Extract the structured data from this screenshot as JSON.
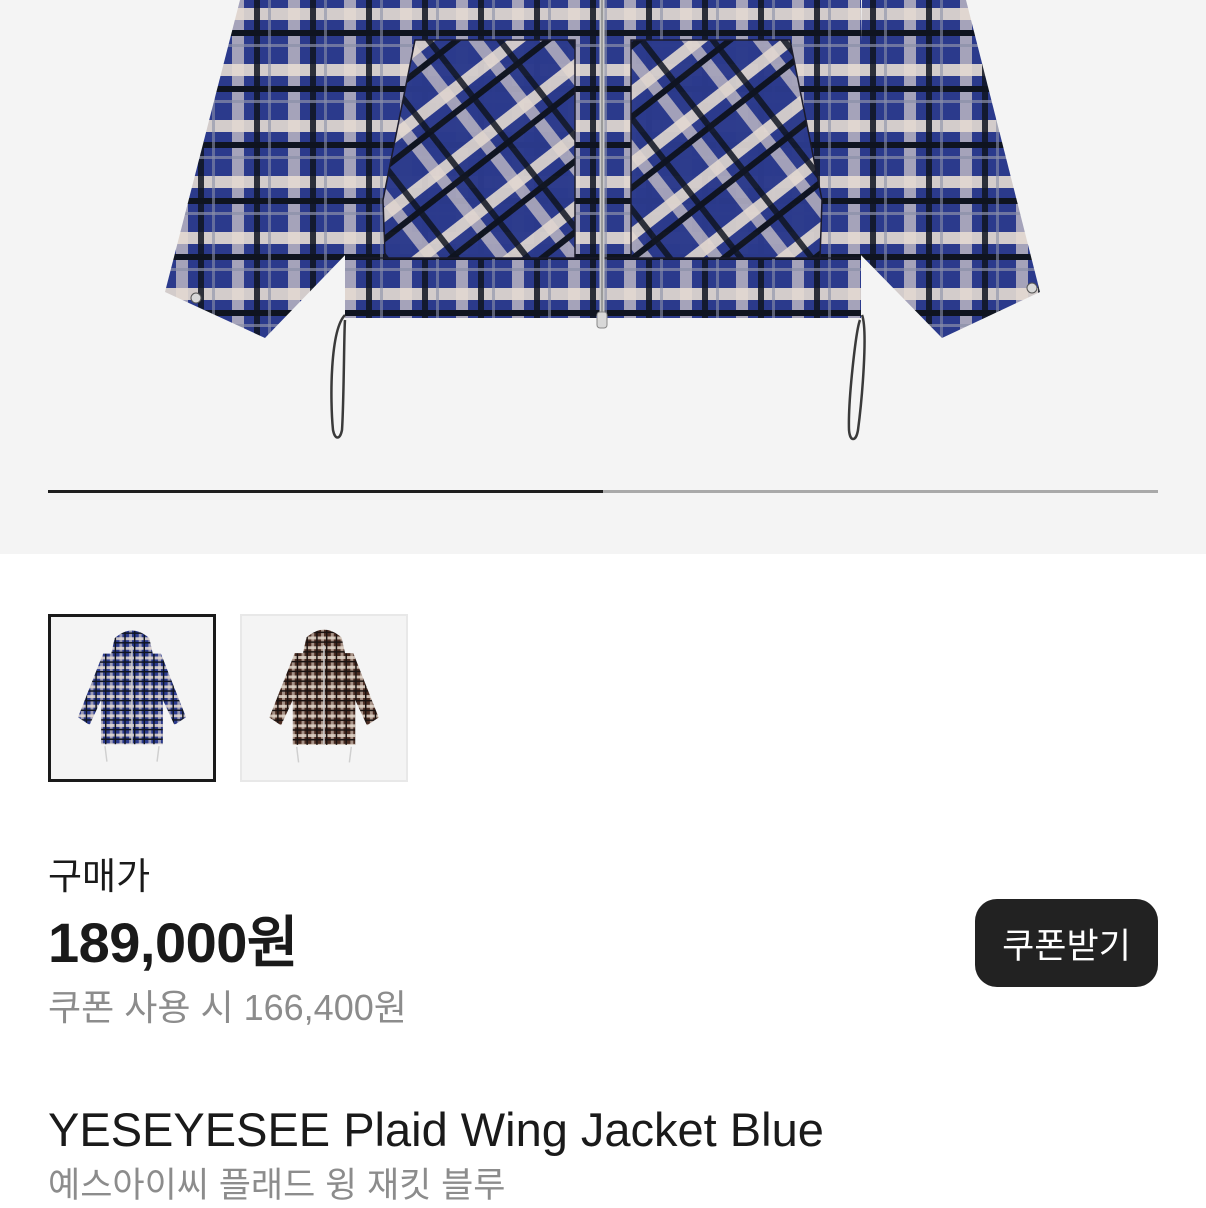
{
  "gallery": {
    "progress_fraction": 0.5,
    "colors": {
      "fill": "#1e1e1e",
      "track": "#a9a9a9",
      "background": "#f4f4f4"
    },
    "thumbnails": [
      {
        "name": "blue-plaid-jacket",
        "selected": true,
        "plaid_base": "#2b3a8c",
        "plaid_light": "#e6dcd2"
      },
      {
        "name": "brown-plaid-jacket",
        "selected": false,
        "plaid_base": "#4a2c22",
        "plaid_light": "#e2d6ca"
      }
    ]
  },
  "pricing": {
    "label": "구매가",
    "price": "189,000원",
    "coupon_price": "쿠폰 사용 시 166,400원",
    "coupon_button_label": "쿠폰받기"
  },
  "product": {
    "title_en": "YESEYESEE Plaid Wing Jacket Blue",
    "title_ko": "예스아이씨 플래드 윙 재킷 블루"
  }
}
